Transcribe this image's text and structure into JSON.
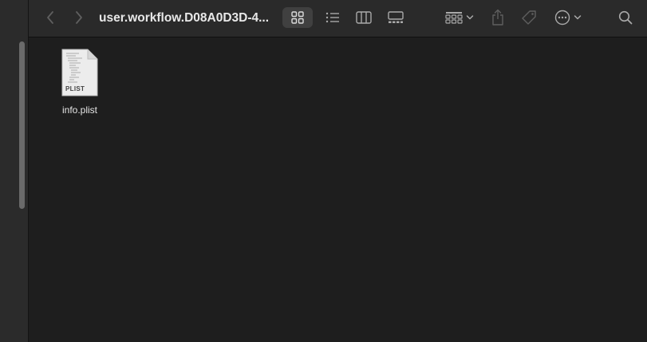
{
  "window": {
    "title": "user.workflow.D08A0D3D-4..."
  },
  "toolbar": {
    "back_icon": "chevron-left-icon",
    "forward_icon": "chevron-right-icon",
    "view_modes": [
      "icon-view-icon",
      "list-view-icon",
      "column-view-icon",
      "gallery-view-icon"
    ],
    "active_view": "icon",
    "group_icon": "group-grid-icon",
    "share_icon": "share-icon",
    "tag_icon": "tag-icon",
    "more_icon": "ellipsis-circle-icon",
    "search_icon": "search-icon"
  },
  "files": [
    {
      "name": "info.plist",
      "badge": "PLIST"
    }
  ],
  "colors": {
    "background": "#1e1e1e",
    "toolbar": "#2a2a2a",
    "sidebar": "#2b2b2b",
    "text": "#e6e6e6"
  }
}
